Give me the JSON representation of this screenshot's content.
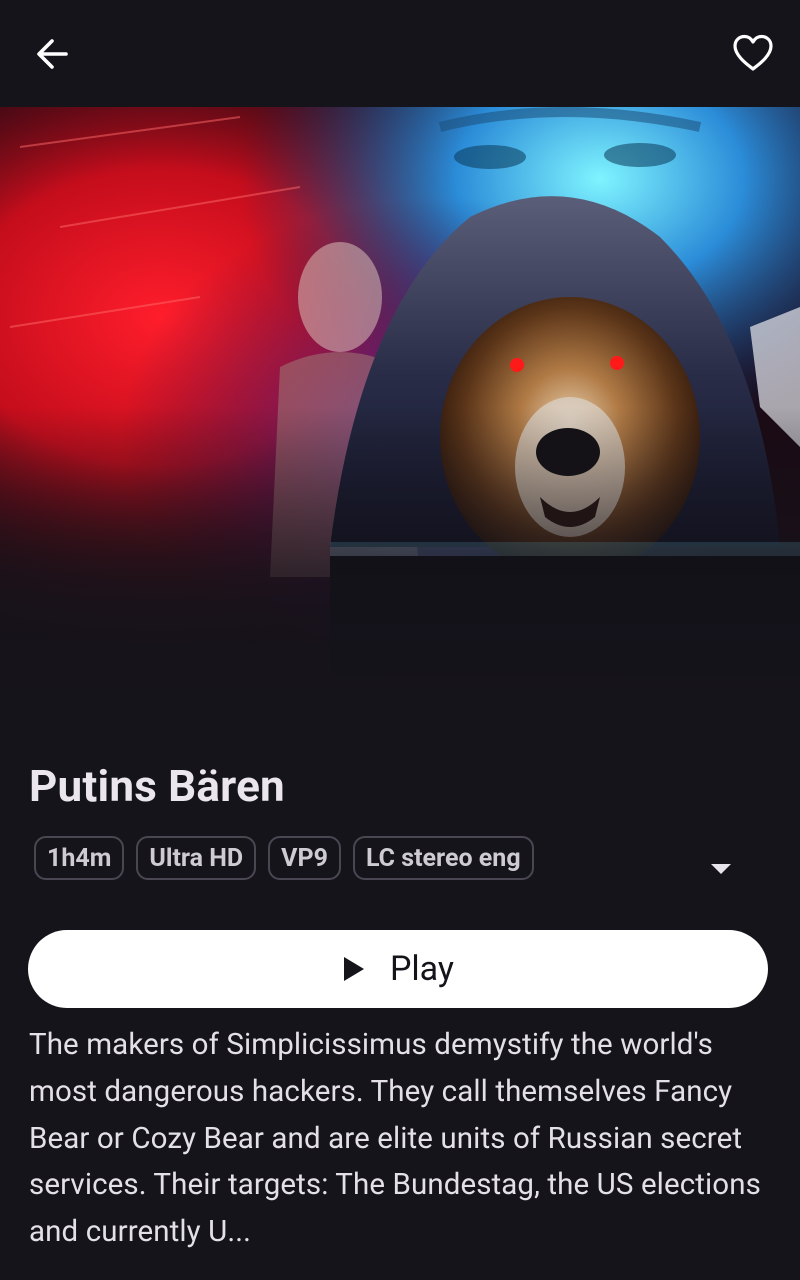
{
  "header": {
    "back_icon": "arrow-left-icon",
    "favorite_icon": "heart-outline-icon"
  },
  "hero": {
    "image": "poster artwork: hooded bear with red eyes in front of laptop, faces in background, red and blue glow"
  },
  "movie": {
    "title": "Putins Bären",
    "chips": [
      "1h4m",
      "Ultra HD",
      "VP9",
      "LC stereo eng"
    ],
    "expand_icon": "caret-down-icon",
    "play_label": "Play",
    "play_icon": "play-icon",
    "description": "The makers of Simplicissimus demystify the world's most dangerous hackers. They call themselves Fancy Bear or Cozy Bear and are elite units of Russian secret services. Their targets: The Bundestag, the US elections and currently U..."
  },
  "colors": {
    "background": "#16141b",
    "title": "#ebe6ee",
    "chip_border": "#4a4652",
    "chip_text": "#cfcbd3",
    "play_button": "#ffffff",
    "description": "#e4e0e8"
  }
}
